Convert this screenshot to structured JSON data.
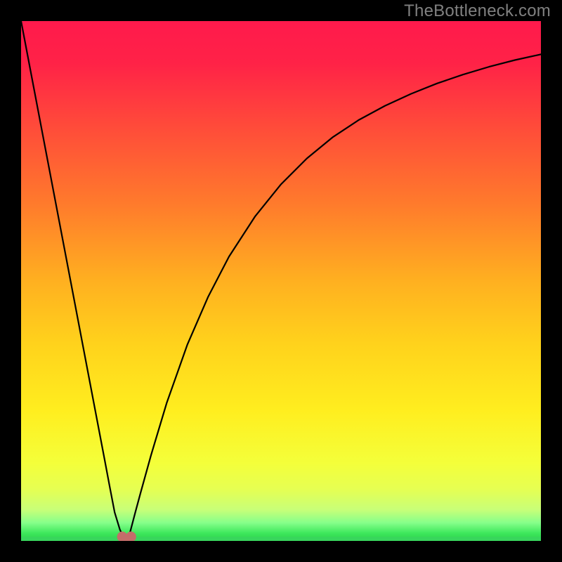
{
  "watermark": {
    "text": "TheBottleneck.com"
  },
  "colors": {
    "gradient_stops": [
      {
        "offset": 0.0,
        "color": "#ff1a4c"
      },
      {
        "offset": 0.08,
        "color": "#ff2247"
      },
      {
        "offset": 0.2,
        "color": "#ff4a3a"
      },
      {
        "offset": 0.35,
        "color": "#ff7a2c"
      },
      {
        "offset": 0.5,
        "color": "#ffb020"
      },
      {
        "offset": 0.62,
        "color": "#ffd21c"
      },
      {
        "offset": 0.75,
        "color": "#ffee1f"
      },
      {
        "offset": 0.85,
        "color": "#f4ff3a"
      },
      {
        "offset": 0.9,
        "color": "#e6ff52"
      },
      {
        "offset": 0.94,
        "color": "#c8ff78"
      },
      {
        "offset": 0.965,
        "color": "#86ff8a"
      },
      {
        "offset": 0.985,
        "color": "#3ee85c"
      },
      {
        "offset": 1.0,
        "color": "#2ad04a"
      }
    ],
    "curve_stroke": "#000000",
    "marker_color": "#c46d6a",
    "baseline_color": "#38d65c",
    "frame_color": "#000000"
  },
  "chart_data": {
    "type": "line",
    "title": "",
    "xlabel": "",
    "ylabel": "",
    "xlim": [
      0,
      100
    ],
    "ylim": [
      0,
      100
    ],
    "grid": false,
    "legend": false,
    "x": [
      0,
      4,
      8,
      12,
      14,
      16,
      17,
      18,
      19,
      20,
      20.5,
      21,
      22,
      23,
      25,
      28,
      32,
      36,
      40,
      45,
      50,
      55,
      60,
      65,
      70,
      75,
      80,
      85,
      90,
      95,
      100
    ],
    "values": [
      100,
      79,
      58,
      37,
      26.5,
      16,
      10.7,
      5.5,
      2.2,
      0,
      0,
      1.8,
      5.6,
      9.3,
      16.5,
      26.5,
      37.8,
      47.0,
      54.7,
      62.4,
      68.6,
      73.6,
      77.7,
      81.0,
      83.7,
      86.0,
      88.0,
      89.7,
      91.2,
      92.5,
      93.6
    ],
    "minimum_marker": {
      "x": 20.3,
      "y": 0,
      "radius": 1.7
    },
    "baseline_y": 0
  }
}
